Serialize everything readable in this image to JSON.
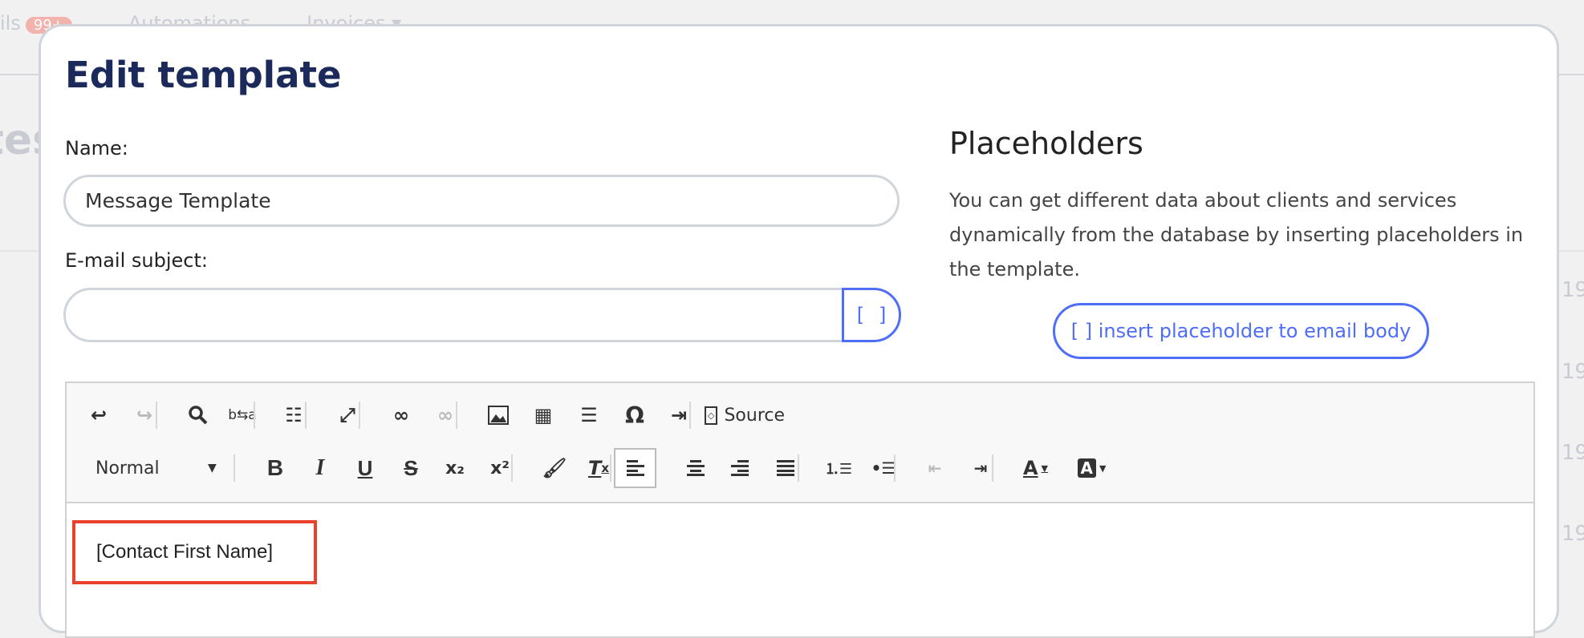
{
  "background": {
    "topbar": {
      "item1": "ils",
      "item1_badge": "99+",
      "item2": "Automations",
      "item3": "Invoices ▾"
    },
    "section_title_fragment": "tes",
    "row_values": [
      "19",
      "19",
      "19",
      "19"
    ]
  },
  "modal": {
    "title": "Edit template",
    "name_label": "Name:",
    "name_value": "Message Template",
    "subject_label": "E-mail subject:",
    "subject_value": "",
    "subject_placeholder_button": "[ ]",
    "placeholders": {
      "heading": "Placeholders",
      "description": "You can get different data about clients and services dynamically from the database by inserting placeholders in the template.",
      "insert_button": "[ ] insert placeholder to email body"
    },
    "editor": {
      "source_label": "Source",
      "format_select": "Normal",
      "content": "[Contact First Name]"
    }
  },
  "colors": {
    "accent": "#4f6ef7",
    "title": "#1b2a5a",
    "highlight": "#e8412c"
  }
}
